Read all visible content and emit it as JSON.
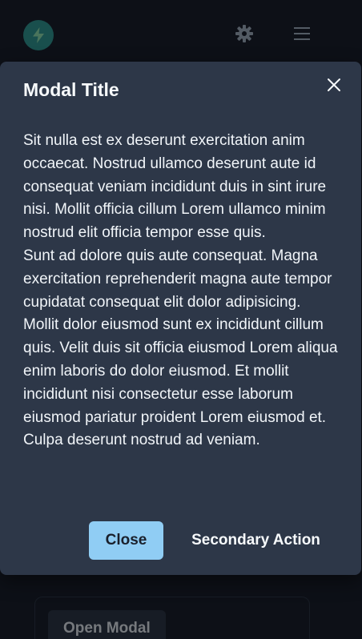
{
  "header": {
    "logo_icon": "lightning-bolt-icon",
    "theme_icon": "gear-icon",
    "menu_icon": "hamburger-menu-icon"
  },
  "content": {
    "open_modal_label": "Open Modal"
  },
  "modal": {
    "title": "Modal Title",
    "close_icon": "close-icon",
    "paragraphs": [
      "Sit nulla est ex deserunt exercitation anim occaecat. Nostrud ullamco deserunt aute id consequat veniam incididunt duis in sint irure nisi. Mollit officia cillum Lorem ullamco minim nostrud elit officia tempor esse quis.",
      "Sunt ad dolore quis aute consequat. Magna exercitation reprehenderit magna aute tempor cupidatat consequat elit dolor adipisicing. Mollit dolor eiusmod sunt ex incididunt cillum quis. Velit duis sit officia eiusmod Lorem aliqua enim laboris do dolor eiusmod. Et mollit incididunt nisi consectetur esse laborum eiusmod pariatur proident Lorem eiusmod et. Culpa deserunt nostrud ad veniam."
    ],
    "close_label": "Close",
    "secondary_label": "Secondary Action"
  },
  "colors": {
    "background": "#1a202c",
    "modal_background": "#2d3748",
    "primary_button": "#90cdf4",
    "logo": "#319795"
  }
}
